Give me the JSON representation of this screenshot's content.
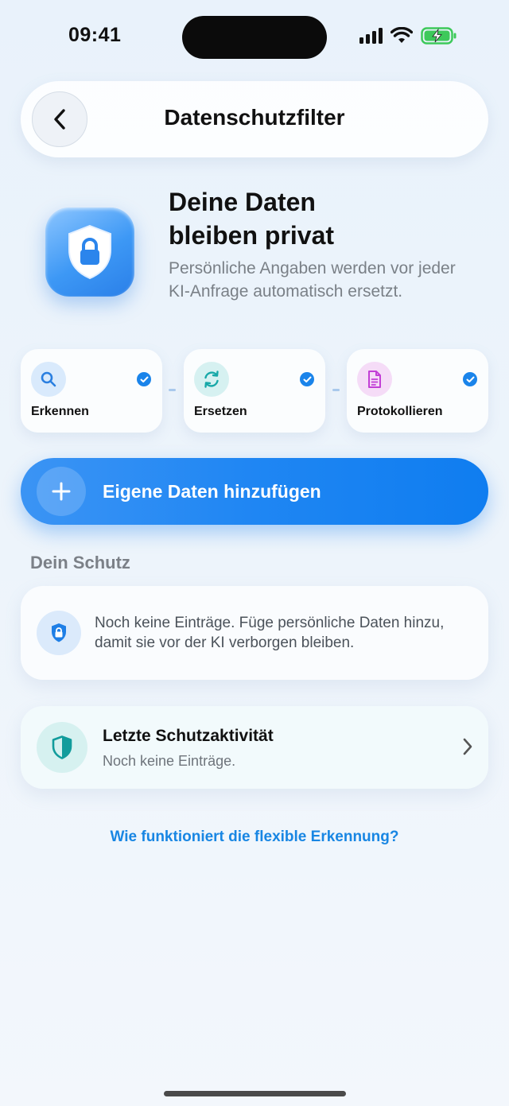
{
  "status_bar": {
    "time": "09:41",
    "icons": [
      "cellular-signal-icon",
      "wifi-icon",
      "battery-charging-icon"
    ],
    "battery_color": "#3dc95a"
  },
  "header": {
    "title": "Datenschutzfilter",
    "back_icon": "chevron-left-icon"
  },
  "hero": {
    "title_line1": "Deine Daten",
    "title_line2": "bleiben privat",
    "subtitle": "Persönliche Angaben werden vor jeder KI-Anfrage automatisch ersetzt.",
    "icon": "shield-lock-icon"
  },
  "steps": [
    {
      "label": "Erkennen",
      "icon": "search-icon",
      "color": "#2a7fe0",
      "checked": true
    },
    {
      "label": "Ersetzen",
      "icon": "refresh-icon",
      "color": "#17a8a8",
      "checked": true
    },
    {
      "label": "Protokollieren",
      "icon": "document-icon",
      "color": "#c23fd6",
      "checked": true
    }
  ],
  "primary_action": {
    "label": "Eigene Daten hinzufügen",
    "icon": "plus-icon"
  },
  "section": {
    "title": "Dein Schutz"
  },
  "empty_state": {
    "text": "Noch keine Einträge. Füge persönliche Daten hinzu, damit sie vor der KI verborgen bleiben.",
    "icon": "shield-lock-icon"
  },
  "activity": {
    "title": "Letzte Schutzaktivität",
    "subtitle": "Noch keine Einträge.",
    "icon": "shield-icon",
    "chevron": "chevron-right-icon"
  },
  "help_link": "Wie funktioniert die flexible Erkennung?",
  "colors": {
    "accent": "#1f86f3",
    "link": "#1886e3",
    "teal": "#17a8a8"
  }
}
